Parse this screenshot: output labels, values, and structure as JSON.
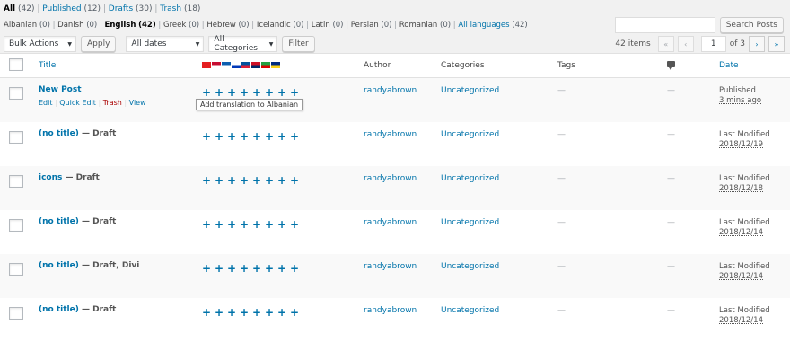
{
  "status_filters": [
    {
      "label": "All",
      "count": "(42)",
      "current": true
    },
    {
      "label": "Published",
      "count": "(12)",
      "current": false
    },
    {
      "label": "Drafts",
      "count": "(30)",
      "current": false
    },
    {
      "label": "Trash",
      "count": "(18)",
      "current": false
    }
  ],
  "language_filters": [
    {
      "label": "Albanian",
      "count": "(0)"
    },
    {
      "label": "Danish",
      "count": "(0)"
    },
    {
      "label": "English",
      "count": "(42)",
      "current": true
    },
    {
      "label": "Greek",
      "count": "(0)"
    },
    {
      "label": "Hebrew",
      "count": "(0)"
    },
    {
      "label": "Icelandic",
      "count": "(0)"
    },
    {
      "label": "Latin",
      "count": "(0)"
    },
    {
      "label": "Persian",
      "count": "(0)"
    },
    {
      "label": "Romanian",
      "count": "(0)"
    },
    {
      "label": "All languages",
      "count": "(42)",
      "link": true
    }
  ],
  "search": {
    "button": "Search Posts",
    "value": ""
  },
  "toolbar": {
    "bulk_actions": "Bulk Actions",
    "apply": "Apply",
    "dates": "All dates",
    "categories": "All Categories",
    "filter": "Filter"
  },
  "pagination": {
    "items": "42 items",
    "first": "«",
    "prev": "‹",
    "current_page": "1",
    "of_total": "of 3",
    "next": "›",
    "last": "»"
  },
  "columns": {
    "title": "Title",
    "author": "Author",
    "categories": "Categories",
    "tags": "Tags",
    "date": "Date"
  },
  "flags": [
    {
      "name": "albania-flag",
      "colors": [
        "#e41e20",
        "#e41e20"
      ]
    },
    {
      "name": "denmark-flag",
      "colors": [
        "#c60c30",
        "#ffffff"
      ]
    },
    {
      "name": "greece-flag",
      "colors": [
        "#0d5eaf",
        "#ffffff"
      ]
    },
    {
      "name": "israel-flag",
      "colors": [
        "#ffffff",
        "#0038b8"
      ]
    },
    {
      "name": "iceland-flag",
      "colors": [
        "#02529c",
        "#dc1e35"
      ]
    },
    {
      "name": "lao-flag",
      "colors": [
        "#ce1126",
        "#002868"
      ]
    },
    {
      "name": "iran-flag",
      "colors": [
        "#239f40",
        "#da0000"
      ]
    },
    {
      "name": "romania-flag",
      "colors": [
        "#002b7f",
        "#fcd116"
      ]
    }
  ],
  "posts": [
    {
      "title": "New Post",
      "state": "",
      "actions": {
        "edit": "Edit",
        "quick_edit": "Quick Edit",
        "trash": "Trash",
        "view": "View"
      },
      "author": "randyabrown",
      "category": "Uncategorized",
      "tags": "—",
      "comments": "—",
      "date_status": "Published",
      "date": "3 mins ago"
    },
    {
      "title": "(no title)",
      "state": " — Draft",
      "author": "randyabrown",
      "category": "Uncategorized",
      "tags": "—",
      "comments": "—",
      "date_status": "Last Modified",
      "date": "2018/12/19"
    },
    {
      "title": "icons",
      "state": " — Draft",
      "author": "randyabrown",
      "category": "Uncategorized",
      "tags": "—",
      "comments": "—",
      "date_status": "Last Modified",
      "date": "2018/12/18"
    },
    {
      "title": "(no title)",
      "state": " — Draft",
      "author": "randyabrown",
      "category": "Uncategorized",
      "tags": "—",
      "comments": "—",
      "date_status": "Last Modified",
      "date": "2018/12/14"
    },
    {
      "title": "(no title)",
      "state": " — Draft, Divi",
      "author": "randyabrown",
      "category": "Uncategorized",
      "tags": "—",
      "comments": "—",
      "date_status": "Last Modified",
      "date": "2018/12/14"
    },
    {
      "title": "(no title)",
      "state": " — Draft",
      "author": "randyabrown",
      "category": "Uncategorized",
      "tags": "—",
      "comments": "—",
      "date_status": "Last Modified",
      "date": "2018/12/14"
    }
  ],
  "plus_symbol": "+",
  "tooltip": "Add translation to Albanian"
}
